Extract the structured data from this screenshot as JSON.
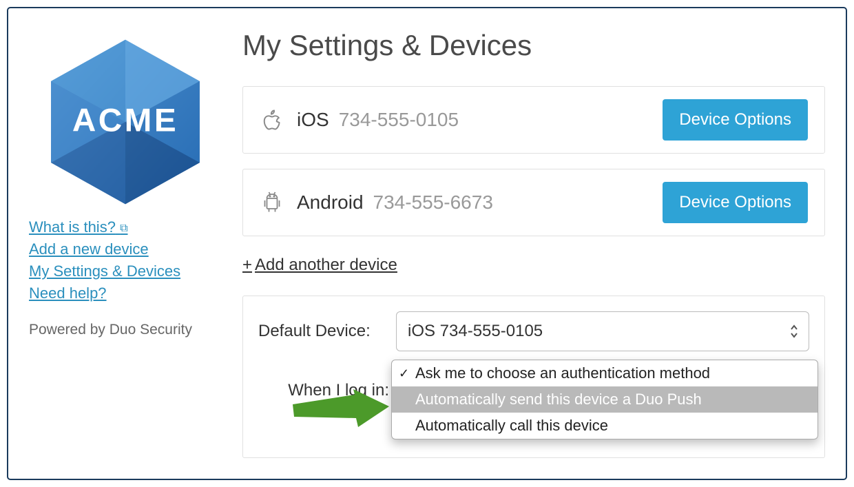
{
  "sidebar": {
    "links": {
      "what_is_this": "What is this?",
      "add_device": "Add a new device",
      "my_settings": "My Settings & Devices",
      "need_help": "Need help?"
    },
    "powered": "Powered by Duo Security",
    "logo_text": "ACME"
  },
  "main": {
    "title": "My Settings & Devices",
    "devices": [
      {
        "platform": "iOS",
        "phone": "734-555-0105",
        "icon": "apple-icon",
        "button": "Device Options"
      },
      {
        "platform": "Android",
        "phone": "734-555-6673",
        "icon": "android-icon",
        "button": "Device Options"
      }
    ],
    "add_another": "Add another device",
    "default_device_label": "Default Device:",
    "default_device_value": "iOS 734-555-0105",
    "when_login_label": "When I log in:",
    "dropdown": {
      "options": [
        "Ask me to choose an authentication method",
        "Automatically send this device a Duo Push",
        "Automatically call this device"
      ],
      "checked_index": 0,
      "highlighted_index": 1
    }
  },
  "colors": {
    "accent_blue": "#2ea3d6",
    "arrow_green": "#4c9a2a"
  }
}
